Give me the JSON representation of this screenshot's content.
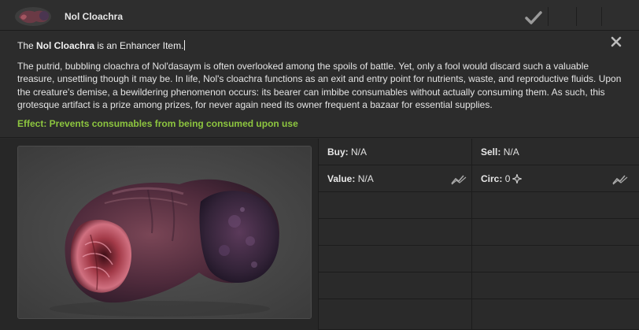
{
  "header": {
    "title": "Nol Cloachra",
    "thumbnail_icon": "nol-cloachra-thumbnail",
    "check_icon": "checkmark-icon"
  },
  "description": {
    "intro_prefix": "The ",
    "item_name": "Nol Cloachra",
    "intro_suffix": " is an Enhancer Item.",
    "lore": "The putrid, bubbling cloachra of Nol'dasaym is often overlooked among the spoils of battle. Yet, only a fool would discard such a valuable treasure, unsettling though it may be. In life, Nol's cloachra functions as an exit and entry point for nutrients, waste, and reproductive fluids. Upon the creature's demise, a bewildering phenomenon occurs: its bearer can imbibe consumables without actually consuming them. As such, this grotesque artifact is a prize among prizes, for never again need its owner frequent a bazaar for essential supplies.",
    "effect": "Effect: Prevents consumables from being consumed upon use",
    "effect_color": "#8dc63f",
    "close_icon": "close-icon"
  },
  "stats": {
    "buy_label": "Buy:",
    "buy_value": "N/A",
    "sell_label": "Sell:",
    "sell_value": "N/A",
    "value_label": "Value:",
    "value_value": "N/A",
    "circ_label": "Circ:",
    "circ_value": "0",
    "trend_icon": "trend-chart-icon",
    "sparkle_icon": "sparkle-icon"
  }
}
